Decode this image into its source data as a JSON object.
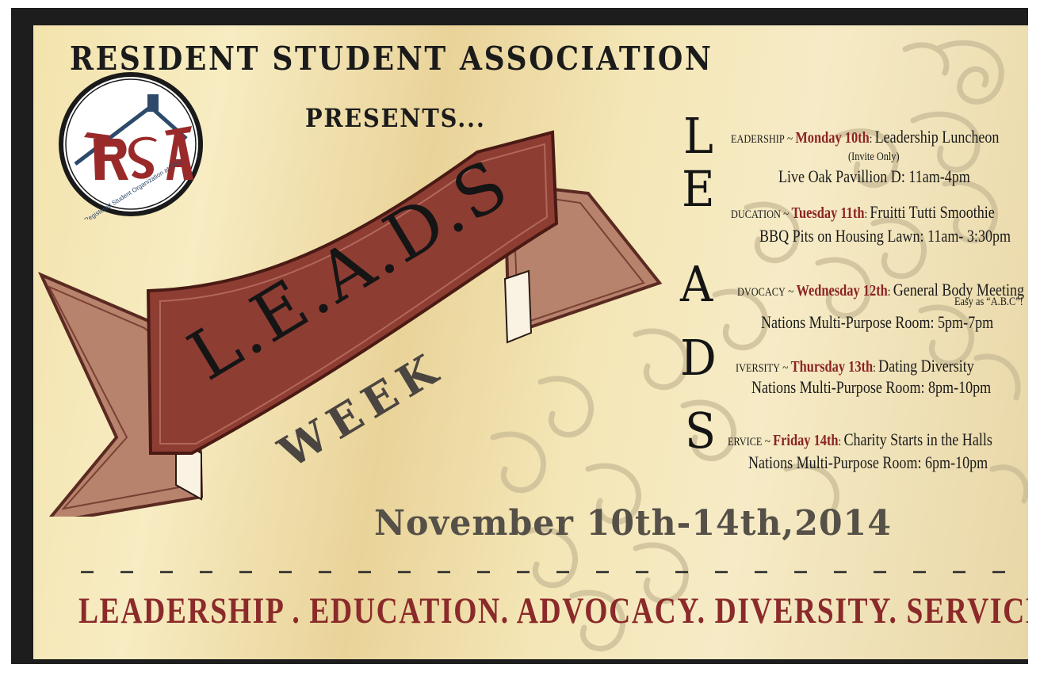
{
  "title": "RESIDENT STUDENT ASSOCIATION",
  "presents": "PRESENTS...",
  "logo": {
    "text": "RSA",
    "tagline": "A Registered Student Organization at FAU",
    "icon": "house-roof-icon"
  },
  "banner": {
    "main": "L.E.A.D.S",
    "sub": "WEEK"
  },
  "events": [
    {
      "letter": "L",
      "rest": "EADERSHIP",
      "sep": "~",
      "day": "Monday 10th",
      "name": "Leadership Luncheon",
      "note": "(Invite Only)",
      "location": "Live Oak Pavillion D: 11am-4pm"
    },
    {
      "letter": "E",
      "rest": "DUCATION",
      "sep": "~",
      "day": "Tuesday 11th",
      "name": "Fruitti Tutti Smoothie",
      "location": "BBQ Pits on Housing Lawn: 11am- 3:30pm"
    },
    {
      "letter": "A",
      "rest": "DVOCACY",
      "sep": "~",
      "day": "Wednesday 12th",
      "name": "General Body Meeting",
      "note": "Easy as “A.B.C”!",
      "location": "Nations Multi-Purpose Room: 5pm-7pm"
    },
    {
      "letter": "D",
      "rest": "IVERSITY",
      "sep": "~",
      "day": "Thursday 13th",
      "name": "Dating Diversity",
      "location": "Nations Multi-Purpose Room: 8pm-10pm"
    },
    {
      "letter": "S",
      "rest": "ERVICE",
      "sep": "~",
      "day": "Friday 14th",
      "name": "Charity Starts in the Halls",
      "location": "Nations Multi-Purpose Room: 6pm-10pm"
    }
  ],
  "date": "November 10th-14th,2014",
  "footer": "LEADERSHIP . EDUCATION. ADVOCACY. DIVERSITY. SERVICE",
  "colors": {
    "accent": "#8b2a2a",
    "ribbon_dark": "#8e3d33",
    "ribbon_light": "#b47f68",
    "gold": "#f3e3ad",
    "frame": "#1d1d1d"
  }
}
